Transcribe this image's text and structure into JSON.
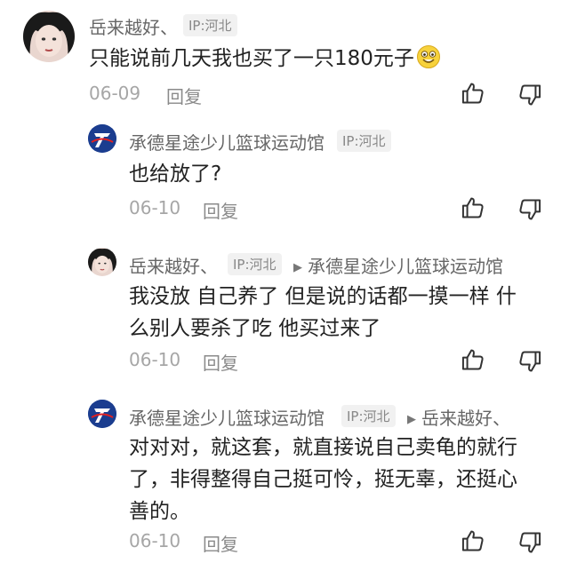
{
  "comments": [
    {
      "user": "岳来越好、",
      "ip": "IP:河北",
      "text": "只能说前几天我也买了一只180元子",
      "emoji": "smiley-emoji",
      "date": "06-09",
      "reply_label": "回复"
    },
    {
      "user": "承德星途少儿篮球运动馆",
      "ip": "IP:河北",
      "text": "也给放了?",
      "date": "06-10",
      "reply_label": "回复"
    },
    {
      "user": "岳来越好、",
      "ip": "IP:河北",
      "reply_to": "承德星途少儿篮球运动馆",
      "text_line1": "我没放 自己养了 但是说的话都一摸一样 什",
      "text_line2": "么别人要杀了吃 他买过来了",
      "date": "06-10",
      "reply_label": "回复"
    },
    {
      "user": "承德星途少儿篮球运动馆",
      "ip": "IP:河北",
      "reply_to": "岳来越好、",
      "text_line1": "对对对，就这套，就直接说自己卖龟的就行",
      "text_line2": "了，非得整得自己挺可怜，挺无辜，还挺心",
      "text_line3": "善的。",
      "date": "06-10",
      "reply_label": "回复"
    }
  ],
  "icons": {
    "like": "thumbs-up-icon",
    "dislike": "thumbs-down-icon",
    "reply_arrow": "triangle-right-icon"
  },
  "colors": {
    "logo_blue": "#1b3d8f",
    "emoji_yellow": "#f7d23c",
    "ip_tag_bg": "#f1f1f1"
  }
}
